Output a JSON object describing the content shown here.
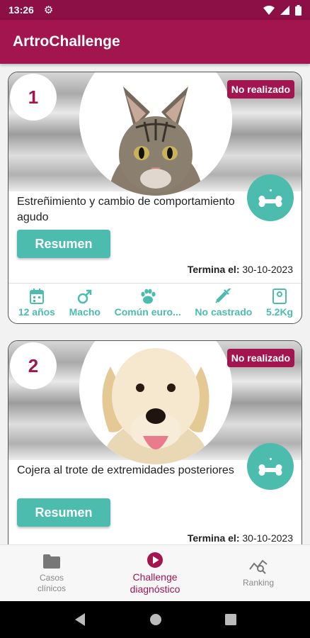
{
  "status_bar": {
    "time": "13:26"
  },
  "app_bar": {
    "title": "ArtroChallenge"
  },
  "cases": [
    {
      "number": "1",
      "status": "No realizado",
      "title": "Estreñimiento y cambio de comportamiento agudo",
      "button": "Resumen",
      "ends_label": "Termina el:",
      "ends_date": "30-10-2023",
      "attributes": [
        "12 años",
        "Macho",
        "Común euro...",
        "No castrado",
        "5.2Kg"
      ]
    },
    {
      "number": "2",
      "status": "No realizado",
      "title": "Cojera al trote de extremidades posteriores",
      "button": "Resumen",
      "ends_label": "Termina el:",
      "ends_date": "30-10-2023"
    }
  ],
  "bottom_nav": [
    {
      "label": "Casos clínicos",
      "icon": "folder-icon"
    },
    {
      "label": "Challenge diagnóstico",
      "icon": "play-icon",
      "active": true
    },
    {
      "label": "Ranking",
      "icon": "ranking-icon"
    }
  ],
  "colors": {
    "primary": "#a3154f",
    "status_bar": "#8c0f45",
    "accent": "#4cbcae"
  }
}
